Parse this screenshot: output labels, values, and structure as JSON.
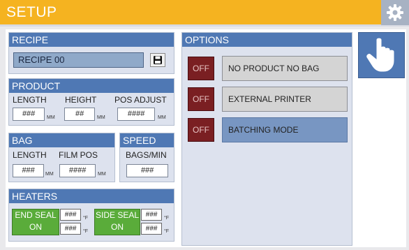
{
  "header": {
    "title": "SETUP"
  },
  "recipe": {
    "title": "RECIPE",
    "value": "RECIPE 00"
  },
  "product": {
    "title": "PRODUCT",
    "length_label": "LENGTH",
    "length_value": "###",
    "length_unit": "MM",
    "height_label": "HEIGHT",
    "height_value": "##",
    "height_unit": "MM",
    "pos_label": "POS ADJUST",
    "pos_value": "####",
    "pos_unit": "MM"
  },
  "bag": {
    "title": "BAG",
    "length_label": "LENGTH",
    "length_value": "###",
    "length_unit": "MM",
    "film_label": "FILM POS",
    "film_value": "####",
    "film_unit": "MM"
  },
  "speed": {
    "title": "SPEED",
    "label": "BAGS/MIN",
    "value": "###"
  },
  "heaters": {
    "title": "HEATERS",
    "end_seal": {
      "line1": "END SEAL",
      "line2": "ON",
      "set": "###",
      "actual": "###",
      "unit": "°F"
    },
    "side_seal": {
      "line1": "SIDE SEAL",
      "line2": "ON",
      "set": "###",
      "actual": "###",
      "unit": "°F"
    }
  },
  "options": {
    "title": "OPTIONS",
    "items": [
      {
        "state": "OFF",
        "label": "NO PRODUCT NO BAG",
        "selected": false
      },
      {
        "state": "OFF",
        "label": "EXTERNAL PRINTER",
        "selected": false
      },
      {
        "state": "OFF",
        "label": "BATCHING MODE",
        "selected": true
      }
    ]
  },
  "icons": {
    "settings": "gear-icon",
    "save": "save-icon",
    "touch": "hand-pointer-icon"
  },
  "colors": {
    "header": "#f5b320",
    "panel_head": "#4f78b4",
    "off": "#7a1f22",
    "on": "#5aac3a",
    "selected": "#7896c2"
  }
}
